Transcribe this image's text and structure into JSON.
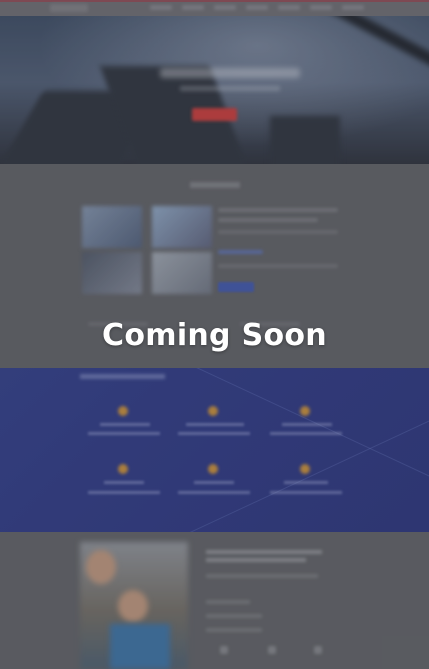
{
  "overlay": {
    "message": "Coming Soon"
  },
  "colors": {
    "hero_cta": "#c23a3a",
    "services_background": "#2f3c86",
    "about_button": "#3e55a8",
    "service_icon": "#c08a3a"
  }
}
